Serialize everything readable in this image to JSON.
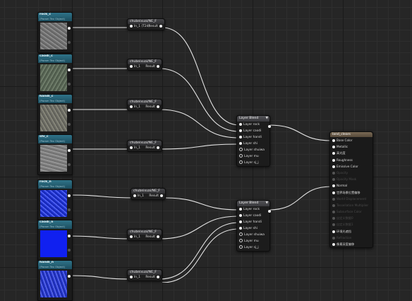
{
  "texture_nodes": [
    {
      "title": "rock_c",
      "sub": "(Param Tex Object)",
      "style": "n-rock"
    },
    {
      "title": "caodi_c",
      "sub": "(Param Tex Object)",
      "style": "n-caodi"
    },
    {
      "title": "handi_c",
      "sub": "(Param Tex Object)",
      "style": "n-handi"
    },
    {
      "title": "shi_c",
      "sub": "(Param Tex Object)",
      "style": "n-shi"
    },
    {
      "title": "rock_n",
      "sub": "(Param Tex Object)",
      "style": "n-rockn"
    },
    {
      "title": "caodi_n",
      "sub": "(Param Tex Object)",
      "style": "n-caodin"
    },
    {
      "title": "handi_n",
      "sub": "(Param Tex Object)",
      "style": "n-handin"
    }
  ],
  "function_nodes": [
    {
      "title": "chubeixuai/NE_F",
      "in": "In_1 (T2d)",
      "out": "Result"
    },
    {
      "title": "chubeixuai/NE_F",
      "in": "In_1",
      "out": "Result"
    },
    {
      "title": "chubeixuai/NE_F",
      "in": "In_1",
      "out": "Result"
    },
    {
      "title": "chubeixuai/NE_F",
      "in": "In_1",
      "out": "Result"
    },
    {
      "title": "chubeixuai/NE_F",
      "in": "In_1",
      "out": "Result"
    },
    {
      "title": "chubeixuai/NE_F",
      "in": "In_1",
      "out": "Result"
    },
    {
      "title": "chubeixuai/NE_F",
      "in": "In_1",
      "out": "Result"
    }
  ],
  "layer_blends": [
    {
      "title": "Layer Blend",
      "layers": [
        "Layer rock",
        "Layer caodi",
        "Layer handi",
        "Layer shi",
        "Layer shuiwa",
        "Layer mu",
        "Layer sj_j"
      ]
    },
    {
      "title": "Layer Blend",
      "layers": [
        "Layer rock",
        "Layer caodi",
        "Layer handi",
        "Layer shi",
        "Layer shuiwa",
        "Layer mu",
        "Layer sj_j"
      ]
    }
  ],
  "material": {
    "title": "land_clears",
    "pins": [
      {
        "label": "Base Color",
        "enabled": true
      },
      {
        "label": "Metallic",
        "enabled": true
      },
      {
        "label": "高光度",
        "enabled": true
      },
      {
        "label": "Roughness",
        "enabled": true
      },
      {
        "label": "Emissive Color",
        "enabled": true
      },
      {
        "label": "Opacity",
        "enabled": false
      },
      {
        "label": "Opacity Mask",
        "enabled": false
      },
      {
        "label": "Normal",
        "enabled": true
      },
      {
        "label": "世界场景位置偏移",
        "enabled": true
      },
      {
        "label": "World Displacement",
        "enabled": false
      },
      {
        "label": "Tessellation Multiplier",
        "enabled": false
      },
      {
        "label": "Subsurface Color",
        "enabled": false
      },
      {
        "label": "自定义数据0",
        "enabled": false
      },
      {
        "label": "自定义数据1",
        "enabled": false
      },
      {
        "label": "环境光遮挡",
        "enabled": true
      },
      {
        "label": "Refraction",
        "enabled": false
      },
      {
        "label": "像素深度偏移",
        "enabled": true
      }
    ]
  },
  "colors": {
    "wire": "#e6e6e6",
    "texture_header": "#2f7389",
    "material_header": "#7a6a55"
  }
}
